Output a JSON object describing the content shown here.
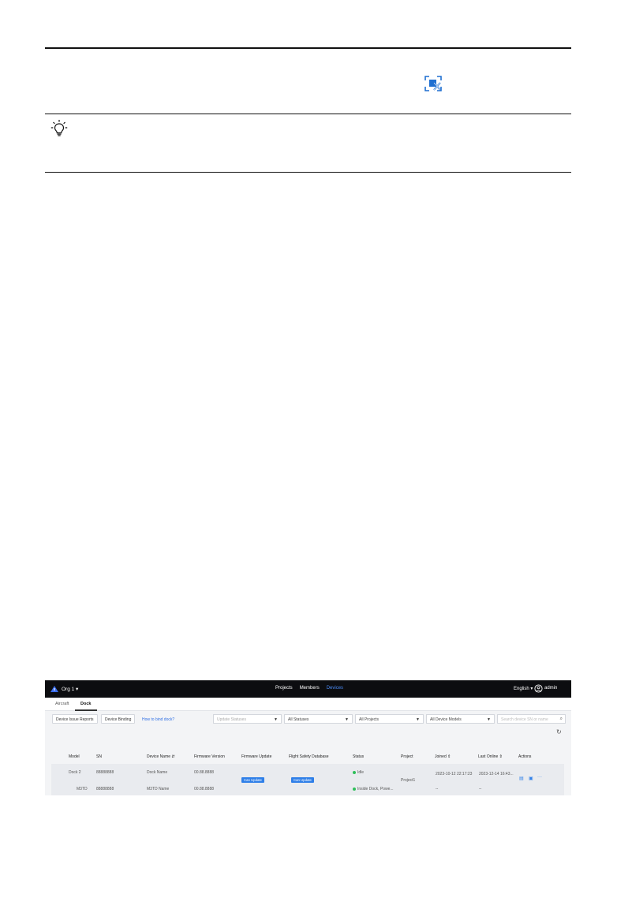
{
  "app": {
    "org": "Org 1 ▾",
    "nav": [
      "Projects",
      "Members",
      "Devices"
    ],
    "active_nav": "Devices",
    "language": "English ▾",
    "user": "admin"
  },
  "tabs": [
    "Aircraft",
    "Dock"
  ],
  "filters": {
    "issue_reports": "Device Issue Reports",
    "binding": "Device Binding",
    "bind_link": "How to bind dock?",
    "update_statuses": "Update Statuses",
    "all_statuses": "All Statuses",
    "all_projects": "All Projects",
    "all_models": "All Device Models",
    "search_placeholder": "Search device SN or name"
  },
  "table": {
    "columns": [
      "Model",
      "SN",
      "Device Name ⇵",
      "Firmware Version",
      "Firmware Update",
      "Flight Safety Database",
      "Status",
      "Project",
      "Joined ⇕",
      "Last Online ⇕",
      "Actions"
    ],
    "rows": [
      {
        "model": "Dock 2",
        "sn": "88888888",
        "name": "Dock Name",
        "firmware": "00.88.8888",
        "status": "Idle",
        "joined": "2023-10-12 22:17:23",
        "last_online": "2023-12-14 16:43..."
      },
      {
        "model": "M3TD",
        "sn": "88888888",
        "name": "M3TD Name",
        "firmware": "00.88.8888",
        "status": "Inside Dock, Powe...",
        "joined": "--",
        "last_online": "--"
      }
    ],
    "firmware_tag": "Can Update",
    "fsdb_tag": "Can Update",
    "project": "Project1",
    "more": "···"
  },
  "colors": {
    "accent": "#2f7fe8",
    "topbar": "#0c0d10",
    "idle": "#2fbf5a"
  }
}
